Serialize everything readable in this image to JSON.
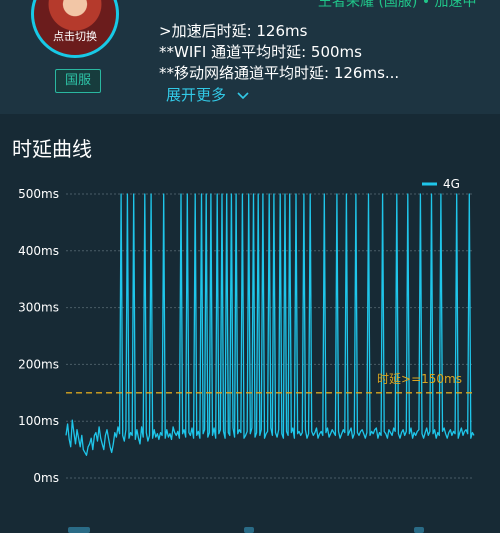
{
  "header": {
    "game_line": "王者荣耀 (国服) • 加速中",
    "switch_label": "点击切换",
    "region_badge": "国服",
    "stats": [
      ">加速后时延: 126ms",
      "**WIFI 通道平均时延: 500ms",
      "**移动网络通道平均时延: 126ms..."
    ],
    "expand_label": "展开更多"
  },
  "chart_data": {
    "type": "line",
    "title": "时延曲线",
    "xlabel": "",
    "ylabel": "",
    "ylim": [
      0,
      500
    ],
    "yticks": [
      "0ms",
      "100ms",
      "200ms",
      "300ms",
      "400ms",
      "500ms"
    ],
    "grid": true,
    "legend": "top-right",
    "series": [
      {
        "name": "4G",
        "color": "#1fc6ea",
        "values": [
          75,
          95,
          68,
          55,
          102,
          80,
          60,
          85,
          70,
          55,
          75,
          50,
          45,
          40,
          55,
          60,
          70,
          50,
          75,
          80,
          65,
          90,
          70,
          60,
          50,
          75,
          85,
          70,
          55,
          45,
          60,
          80,
          72,
          90,
          78,
          500,
          75,
          65,
          85,
          500,
          70,
          80,
          75,
          500,
          68,
          85,
          70,
          60,
          90,
          72,
          500,
          80,
          65,
          75,
          500,
          70,
          85,
          72,
          78,
          68,
          80,
          75,
          500,
          70,
          85,
          72,
          78,
          68,
          90,
          80,
          75,
          82,
          70,
          500,
          78,
          85,
          72,
          500,
          80,
          75,
          88,
          70,
          500,
          75,
          82,
          70,
          500,
          78,
          85,
          500,
          72,
          80,
          500,
          75,
          88,
          70,
          500,
          78,
          85,
          500,
          82,
          70,
          500,
          80,
          75,
          500,
          88,
          72,
          500,
          78,
          85,
          80,
          500,
          70,
          75,
          82,
          500,
          78,
          88,
          500,
          72,
          80,
          500,
          75,
          85,
          500,
          70,
          78,
          82,
          500,
          88,
          75,
          500,
          80,
          72,
          85,
          500,
          78,
          70,
          500,
          82,
          75,
          500,
          80,
          88,
          70,
          500,
          78,
          82,
          75,
          80,
          500,
          85,
          70,
          78,
          500,
          82,
          75,
          80,
          88,
          70,
          78,
          82,
          75,
          500,
          80,
          88,
          72,
          78,
          85,
          80,
          75,
          500,
          82,
          70,
          78,
          85,
          80,
          500,
          75,
          82,
          88,
          70,
          78,
          500,
          80,
          75,
          82,
          85,
          78,
          70,
          80,
          500,
          75,
          82,
          78,
          85,
          88,
          70,
          80,
          75,
          500,
          82,
          78,
          70,
          85,
          80,
          75,
          88,
          82,
          500,
          78,
          70,
          80,
          85,
          75,
          82,
          500,
          78,
          88,
          70,
          80,
          75,
          82,
          85,
          500,
          78,
          70,
          80,
          88,
          75,
          82,
          500,
          78,
          85,
          70,
          80,
          75,
          500,
          82,
          88,
          78,
          70,
          80,
          85,
          75,
          82,
          78,
          500,
          70,
          80,
          88,
          75,
          82,
          85,
          78,
          500,
          70,
          80,
          75
        ]
      }
    ],
    "threshold": {
      "value": 150,
      "label": "时延>=150ms",
      "color": "#d9a520"
    }
  }
}
